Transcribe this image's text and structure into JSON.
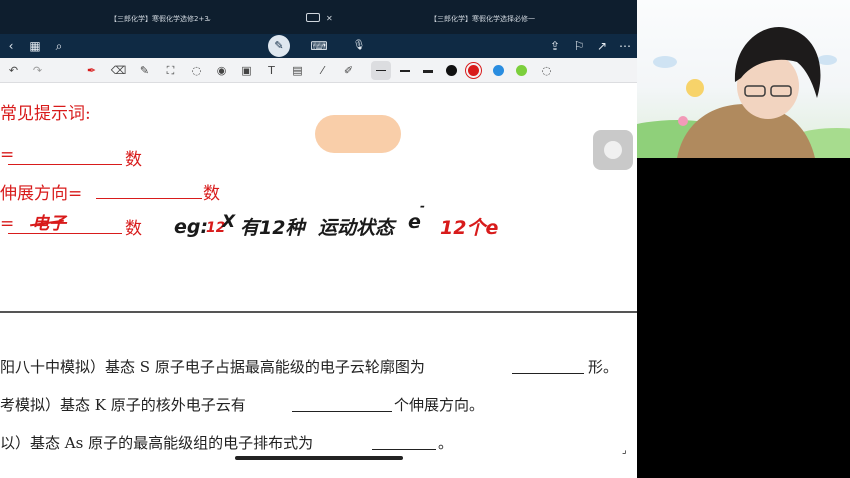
{
  "statusbar": {
    "tab1": "【三郎化学】寒假化学选修2+3",
    "tab1_caret": "⌄",
    "tab2": "【三郎化学】寒假化学选择必修一",
    "close": "✕"
  },
  "navbar": {
    "back_icon": "‹",
    "grid_icon": "▦",
    "search_icon": "⌕",
    "pen_mode_icon": "✎",
    "keyboard_icon": "⌨",
    "mic_icon": "🎙",
    "export_icon": "⇪",
    "bookmark_icon": "⚐",
    "share_icon": "↗",
    "more_icon": "⋯"
  },
  "toolbar": {
    "undo": "↶",
    "redo": "↷",
    "tools": [
      "✒",
      "⌫",
      "✎",
      "⛶",
      "◌",
      "◉",
      "▣",
      "T",
      "▤",
      "⁄",
      "✐"
    ],
    "colors": [
      "#111111",
      "#d81b1b",
      "#2a8de0",
      "#7ccf3c"
    ],
    "picker": "◌"
  },
  "notes": {
    "heading": "常见提示词:",
    "line1_prefix": "=",
    "line1_suffix": "数",
    "line2_prefix": "伸展方向=",
    "line2_suffix": "数",
    "line3_prefix": "=",
    "line3_handwritten": "电子",
    "line3_suffix": "数",
    "example_prefix": "eg:",
    "example_num": "12",
    "example_x": "X",
    "example_mid": "有12种",
    "example_highlight": "运动状态",
    "example_e": "e",
    "example_dash": "-",
    "example_tail": "12个e"
  },
  "questions": [
    {
      "before": "阳八十中模拟）基态 S 原子电子占据最高能级的电子云轮廓图为",
      "after": "形。"
    },
    {
      "before": "考模拟）基态 K 原子的核外电子云有",
      "after": "个伸展方向。"
    },
    {
      "before": "以）基态 As 原子的最高能级组的电子排布式为",
      "after": "。"
    }
  ]
}
